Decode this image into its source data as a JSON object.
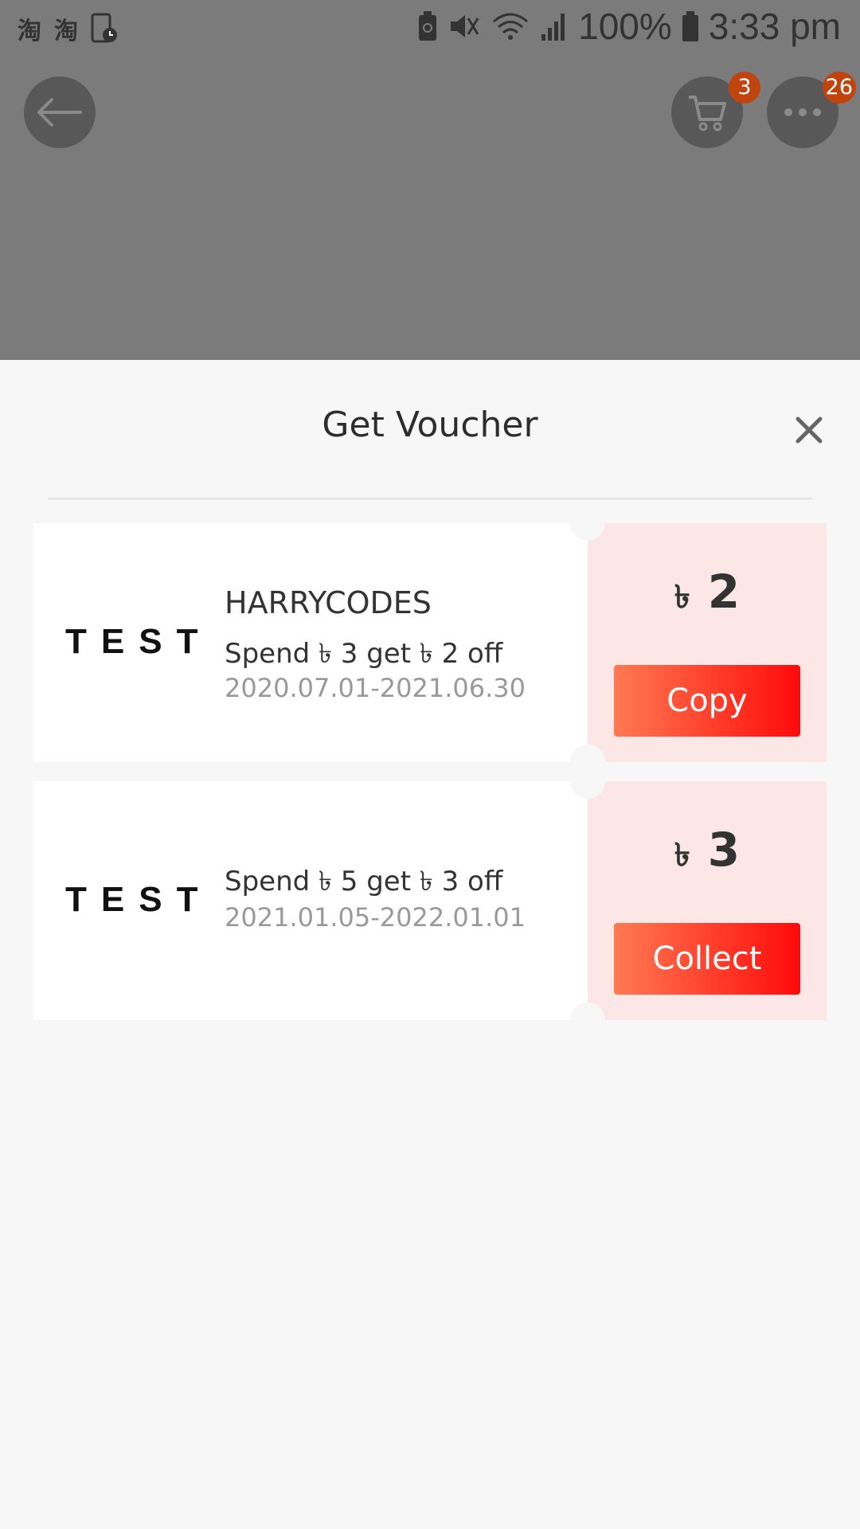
{
  "status_bar": {
    "left_icons": [
      "淘",
      "淘"
    ],
    "battery": "100%",
    "time": "3:33 pm"
  },
  "header": {
    "cart_badge": "3",
    "more_badge": "26"
  },
  "sheet": {
    "title": "Get Voucher"
  },
  "vouchers": [
    {
      "brand": "TEST",
      "code": "HARRYCODES",
      "description": "Spend ৳ 3 get ৳ 2 off",
      "validity": "2020.07.01-2021.06.30",
      "currency": "৳",
      "amount": "2",
      "action": "Copy"
    },
    {
      "brand": "TEST",
      "description": "Spend ৳ 5 get ৳ 3 off",
      "validity": "2021.01.05-2022.01.01",
      "currency": "৳",
      "amount": "3",
      "action": "Collect"
    }
  ],
  "colors": {
    "overlay": "#7b7b7b",
    "badge": "#c1430d",
    "voucher_right_bg": "#fce6e6",
    "button_gradient_start": "#ff7a52",
    "button_gradient_end": "#ff0a0a"
  }
}
